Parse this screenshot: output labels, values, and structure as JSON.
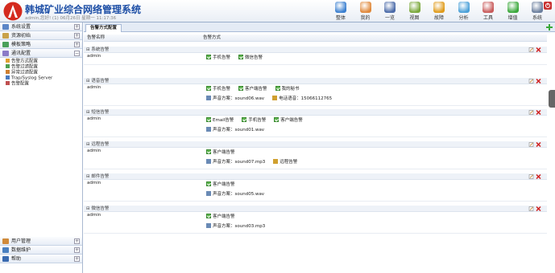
{
  "app": {
    "title": "韩城矿业综合网络管理系统",
    "subtitle": "admin,您好! (1) 06月26日 星期一 11:17:36"
  },
  "toolbar": [
    {
      "label": "整体",
      "icon": "monitor-icon",
      "color": "#3a7fd0"
    },
    {
      "label": "我的",
      "icon": "user-icon",
      "color": "#e0883a"
    },
    {
      "label": "一览",
      "icon": "view-list-icon",
      "color": "#4a6aa8"
    },
    {
      "label": "视图",
      "icon": "topology-icon",
      "color": "#7aa83a"
    },
    {
      "label": "故障",
      "icon": "warning-icon",
      "color": "#e09b1a"
    },
    {
      "label": "分析",
      "icon": "pie-chart-icon",
      "color": "#4aa0d8"
    },
    {
      "label": "工具",
      "icon": "tools-icon",
      "color": "#c85a5a"
    },
    {
      "label": "增值",
      "icon": "plus-icon",
      "color": "#3aa83a"
    },
    {
      "label": "系统",
      "icon": "settings-icon",
      "color": "#6b7f9e"
    }
  ],
  "sidebar": {
    "top": [
      {
        "label": "系统设置",
        "icon": "system-settings-icon",
        "color": "#5b86c7"
      },
      {
        "label": "资源初始",
        "icon": "resource-icon",
        "color": "#c9a24a"
      },
      {
        "label": "模板策略",
        "icon": "template-icon",
        "color": "#4aa05a"
      },
      {
        "label": "通讯配置",
        "icon": "communication-icon",
        "color": "#8b7bc7"
      }
    ],
    "tree": [
      {
        "label": "告警方式配置",
        "icon": "alarm-method-icon",
        "color": "#e0a030"
      },
      {
        "label": "告警过滤配置",
        "icon": "alarm-filter-icon",
        "color": "#50a050"
      },
      {
        "label": "异常过滤配置",
        "icon": "exception-filter-icon",
        "color": "#d08030"
      },
      {
        "label": "Trap/Syslog Server",
        "icon": "trap-server-icon",
        "color": "#4a7ac0"
      },
      {
        "label": "告警配置",
        "icon": "alarm-config-icon",
        "color": "#c05050"
      }
    ],
    "bottom": [
      {
        "label": "用户管理",
        "icon": "users-icon",
        "color": "#d08a3a"
      },
      {
        "label": "数据维护",
        "icon": "database-icon",
        "color": "#4a80c0"
      },
      {
        "label": "帮助",
        "icon": "help-icon",
        "color": "#3a6ab0"
      }
    ]
  },
  "main": {
    "tab": "告警方式配置",
    "columns": [
      "告警名称",
      "告警方式"
    ],
    "groups": [
      {
        "name": "⊟ 系统告警",
        "user": "admin",
        "lines": [
          [
            "手机告警",
            "微信告警"
          ]
        ],
        "extra": []
      },
      {
        "name": "⊟ 语音告警",
        "user": "admin",
        "lines": [
          [
            "手机告警",
            "客户端告警",
            "我的秘书"
          ]
        ],
        "extra": [
          [
            "声音方案：sound06.wav",
            "电话语音：15066112765"
          ]
        ]
      },
      {
        "name": "⊟ 短信告警",
        "user": "admin",
        "lines": [
          [
            "Email告警",
            "手机告警",
            "客户端告警"
          ]
        ],
        "extra": [
          [
            "声音方案：sound01.wav"
          ]
        ]
      },
      {
        "name": "⊟ 远程告警",
        "user": "admin",
        "lines": [
          [
            "客户端告警"
          ]
        ],
        "extra": [
          [
            "声音方案：sound07.mp3",
            "远程告警"
          ]
        ]
      },
      {
        "name": "⊟ 邮件告警",
        "user": "admin",
        "lines": [
          [
            "客户端告警"
          ]
        ],
        "extra": [
          [
            "声音方案：sound05.wav"
          ]
        ]
      },
      {
        "name": "⊟ 微信告警",
        "user": "admin",
        "lines": [
          [
            "客户端告警"
          ]
        ],
        "extra": [
          [
            "声音方案：sound03.mp3"
          ]
        ]
      }
    ]
  },
  "colors": {
    "brand": "#1e4fa6",
    "check": "#5fb54f",
    "delete": "#d02020"
  }
}
